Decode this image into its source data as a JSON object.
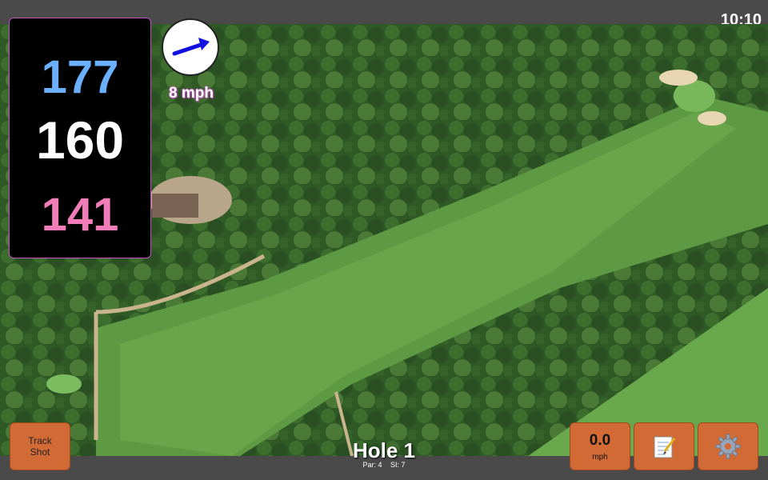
{
  "status": {
    "time": "10:10"
  },
  "yardages": {
    "back": "177",
    "center": "160",
    "front": "141"
  },
  "wind": {
    "speed_label": "8 mph",
    "direction_icon": "arrow-icon"
  },
  "buttons": {
    "track_shot": "Track\nShot",
    "speed_value": "0.0",
    "speed_unit": "mph",
    "notes_icon": "notepad-icon",
    "settings_icon": "gear-icon"
  },
  "hole": {
    "title": "Hole 1",
    "par": "Par: 4",
    "si": "SI: 7"
  },
  "colors": {
    "back_yardage": "#6ab0ff",
    "center_yardage": "#ffffff",
    "front_yardage": "#f07cb8",
    "button": "#d26a36",
    "wind_arrow": "#1010e0"
  }
}
